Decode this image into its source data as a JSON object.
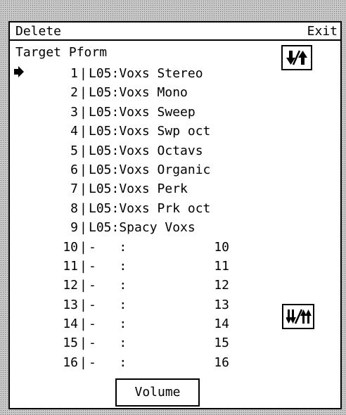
{
  "menu": {
    "left": "Delete",
    "right": "Exit"
  },
  "heading": "Target Pform",
  "icons": {
    "pointer": "right-arrow-pointer-icon",
    "sort": "down-up-arrows-icon",
    "swap": "double-down-double-up-arrows-icon"
  },
  "rows": [
    {
      "num": "1",
      "sep": "|",
      "label": "L05:Voxs Stereo",
      "val": ""
    },
    {
      "num": "2",
      "sep": "|",
      "label": "L05:Voxs Mono",
      "val": ""
    },
    {
      "num": "3",
      "sep": "|",
      "label": "L05:Voxs Sweep",
      "val": ""
    },
    {
      "num": "4",
      "sep": "|",
      "label": "L05:Voxs Swp oct",
      "val": ""
    },
    {
      "num": "5",
      "sep": "|",
      "label": "L05:Voxs Octavs",
      "val": ""
    },
    {
      "num": "6",
      "sep": "|",
      "label": "L05:Voxs Organic",
      "val": ""
    },
    {
      "num": "7",
      "sep": "|",
      "label": "L05:Voxs Perk",
      "val": ""
    },
    {
      "num": "8",
      "sep": "|",
      "label": "L05:Voxs Prk oct",
      "val": ""
    },
    {
      "num": "9",
      "sep": "|",
      "label": "L05:Spacy Voxs",
      "val": ""
    },
    {
      "num": "10",
      "sep": "|",
      "label": "-   :",
      "val": "10"
    },
    {
      "num": "11",
      "sep": "|",
      "label": "-   :",
      "val": "11"
    },
    {
      "num": "12",
      "sep": "|",
      "label": "-   :",
      "val": "12"
    },
    {
      "num": "13",
      "sep": "|",
      "label": "-   :",
      "val": "13"
    },
    {
      "num": "14",
      "sep": "|",
      "label": "-   :",
      "val": "14"
    },
    {
      "num": "15",
      "sep": "|",
      "label": "-   :",
      "val": "15"
    },
    {
      "num": "16",
      "sep": "|",
      "label": "-   :",
      "val": "16"
    }
  ],
  "volume": "Volume"
}
